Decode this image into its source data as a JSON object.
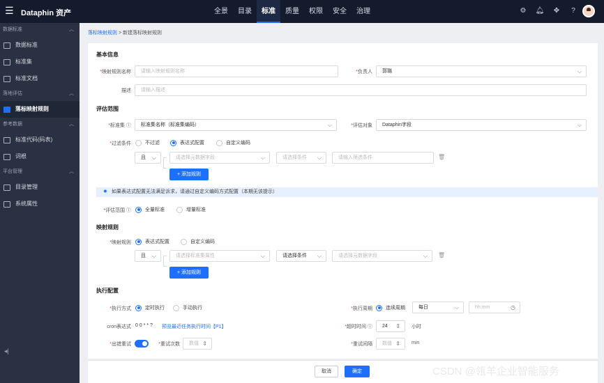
{
  "app": {
    "brand": "Dataphin 资产"
  },
  "topnav": [
    "全景",
    "目录",
    "标准",
    "质量",
    "权限",
    "安全",
    "治理"
  ],
  "topicons": [
    "settings-icon",
    "bell-icon",
    "puzzle-icon",
    "help-icon"
  ],
  "sidebar": {
    "sections": [
      {
        "title": "数据标准",
        "items": [
          "数据标准",
          "标准集",
          "标准文档"
        ]
      },
      {
        "title": "落地评估",
        "items": [
          "落标映射规则"
        ]
      },
      {
        "title": "参考数据",
        "items": [
          "标准代码(码表)",
          "词根"
        ]
      },
      {
        "title": "平台管理",
        "items": [
          "目录管理",
          "系统属性"
        ]
      }
    ],
    "collapse": "◂|"
  },
  "breadcrumb": {
    "parent": "落标映射规则",
    "sep": ">",
    "current": "新建落标映射规则"
  },
  "basic": {
    "title": "基本信息",
    "name_label": "映射规则名称",
    "name_placeholder": "请输入映射规则名称",
    "owner_label": "负责人",
    "owner_value": "郭璐",
    "desc_label": "描述",
    "desc_placeholder": "请输入描述"
  },
  "scope": {
    "title": "评估范围",
    "std_label": "标准集",
    "std_value": "标准集名称（标准集编码）",
    "target_label": "评估对象",
    "target_value": "Dataphin字段",
    "filter_label": "过滤条件",
    "filter_options": [
      "不过滤",
      "表达式配置",
      "自定义编码"
    ],
    "cond_and": "且",
    "cond_field": "请选择元数据字段",
    "cond_op": "请选择条件",
    "cond_val": "请输入筛选条件",
    "add_rule": "+ 添加规则",
    "tip": "如果表达式配置无法满足诉求，请通过自定义编码方式配置（本期无该提示）",
    "range_label": "评估范围",
    "range_options": [
      "全量标准",
      "增量标准"
    ]
  },
  "mapping": {
    "title": "映射规则",
    "rule_label": "映射规则",
    "rule_options": [
      "表达式配置",
      "自定义编码"
    ],
    "cond_and": "且",
    "cond_field": "请选择标准集属性",
    "cond_op": "请选择条件",
    "cond_val": "请选择元数据字段",
    "add_rule": "+ 添加规则"
  },
  "exec": {
    "title": "执行配置",
    "mode_label": "执行方式",
    "mode_options": [
      "定时执行",
      "手动执行"
    ],
    "cycle_label": "执行周期",
    "cycle_option": "连续周期",
    "cycle_value": "每日",
    "time_placeholder": "hh:mm",
    "cron_label": "cron表达式",
    "cron_value": "0 0 * * ?",
    "cron_link": "预览最近任务执行时间【P1】",
    "timeout_label": "超时时间",
    "timeout_value": "24",
    "timeout_unit": "小时",
    "retry_label": "出错重试",
    "retry_count_label": "重试次数",
    "retry_count_placeholder": "数值",
    "interval_label": "重试间隔",
    "interval_placeholder": "数值",
    "interval_unit": "min"
  },
  "footer": {
    "cancel": "取消",
    "confirm": "确定"
  },
  "watermark": "CSDN @瓴羊企业智能服务",
  "colors": {
    "primary": "#1f6fff",
    "topbar": "#141b2d",
    "sidebar": "#2a3142"
  }
}
